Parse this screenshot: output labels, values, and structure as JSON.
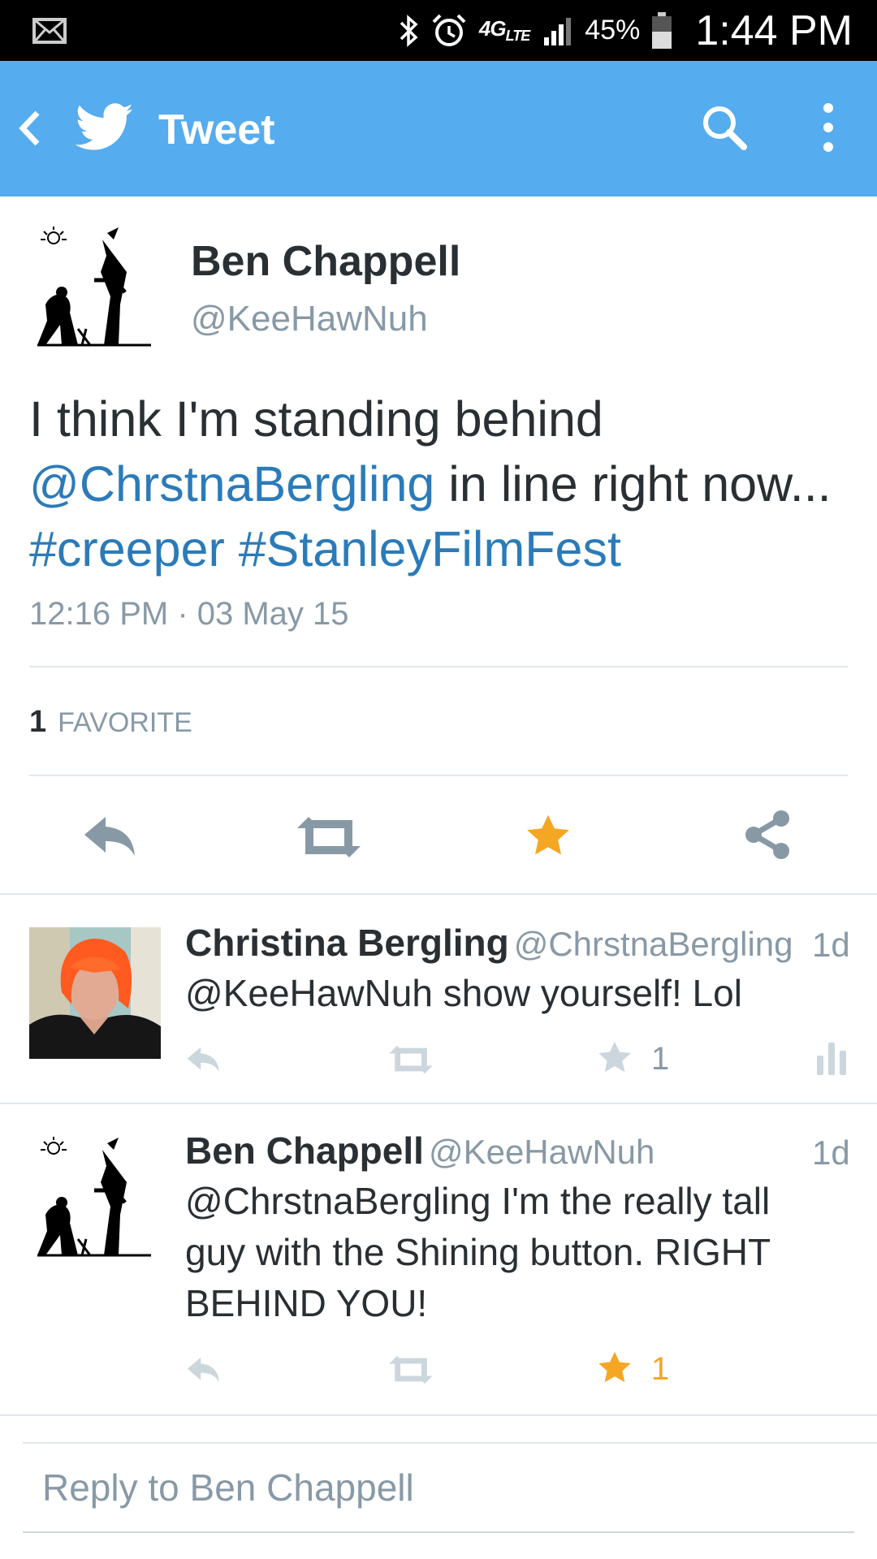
{
  "status_bar": {
    "network": "4G",
    "network_sub": "LTE",
    "battery": "45%",
    "time": "1:44 PM",
    "icons": [
      "mail-icon",
      "bluetooth-icon",
      "alarm-icon",
      "signal-icon",
      "battery-icon"
    ]
  },
  "app_bar": {
    "title": "Tweet",
    "icons": [
      "back-arrow-icon",
      "twitter-bird-icon",
      "search-icon",
      "more-vert-icon"
    ]
  },
  "tweet": {
    "name": "Ben Chappell",
    "handle": "@KeeHawNuh",
    "text_line1": "I think I'm standing behind",
    "mention": "@ChrstnaBergling",
    "text_after_mention": " in line right now...",
    "hashtag1": "#creeper",
    "hashtag2": "#StanleyFilmFest",
    "timestamp": "12:16 PM · 03 May 15",
    "favorite_count": "1",
    "favorite_label": "FAVORITE",
    "actions": [
      "reply-icon",
      "retweet-icon",
      "favorite-star-icon",
      "share-icon"
    ],
    "favorited": true,
    "accent_color": "#f5a623",
    "link_color": "#2b7bb9"
  },
  "replies": [
    {
      "name": "Christina Bergling",
      "handle": "@ChrstnaBergling",
      "age": "1d",
      "text_lines": [
        "@KeeHawNuh show yourself! Lol"
      ],
      "favorites": "1",
      "favorited": false
    },
    {
      "name": "Ben Chappell",
      "handle": "@KeeHawNuh",
      "age": "1d",
      "text_lines": [
        "@ChrstnaBergling I'm the really tall",
        "guy with the Shining button. RIGHT",
        "BEHIND YOU!"
      ],
      "favorites": "1",
      "favorited": true
    }
  ],
  "reply_box": {
    "placeholder": "Reply to Ben Chappell"
  }
}
